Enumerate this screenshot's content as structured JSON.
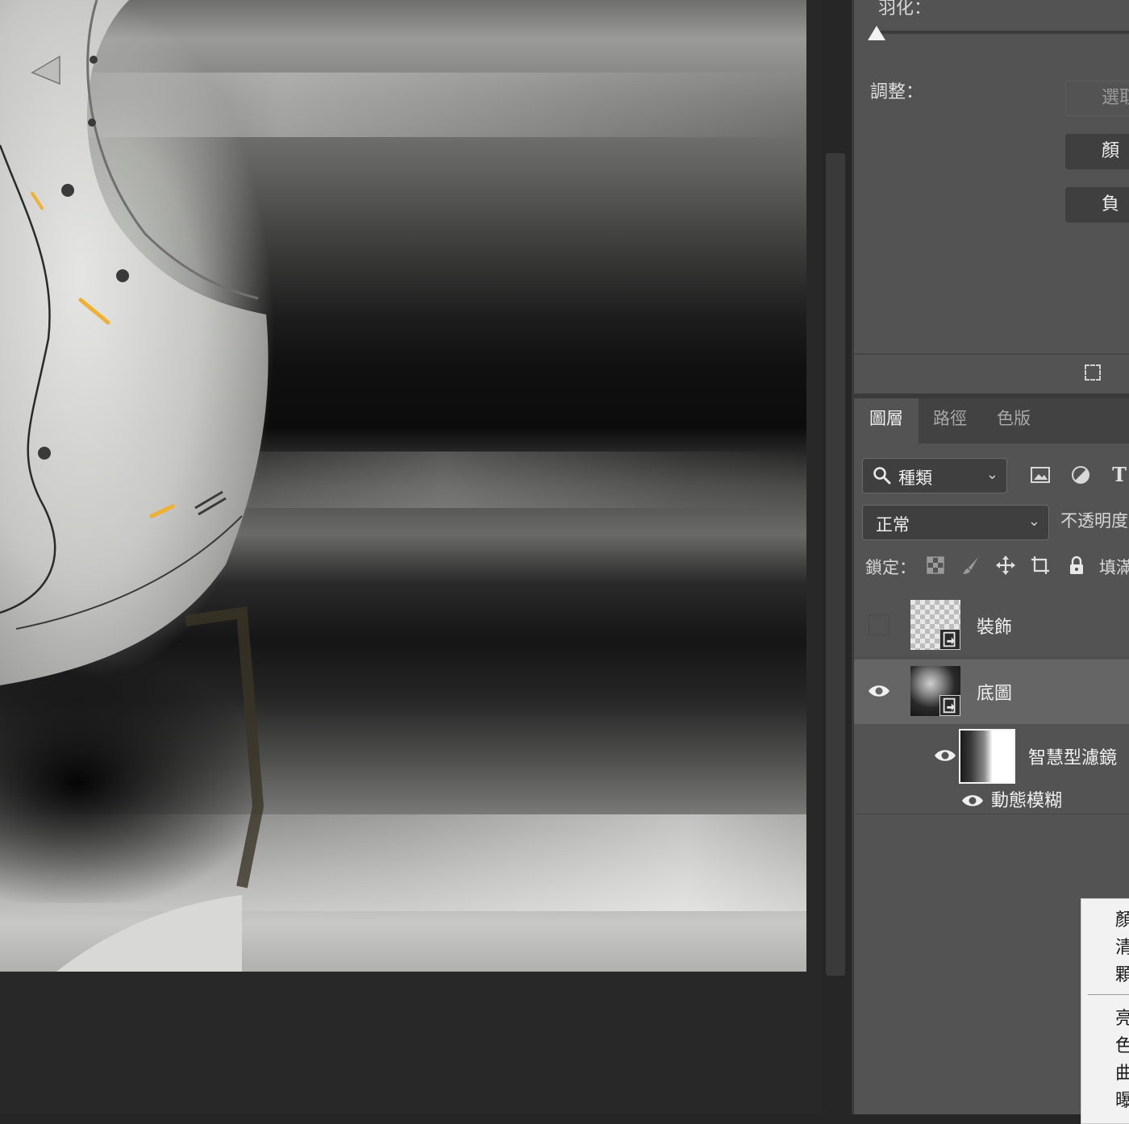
{
  "properties_panel": {
    "feather_label": "羽化：",
    "adjust_label": "調整：",
    "buttons": {
      "select": "選取",
      "color": "顏",
      "negative": "負"
    }
  },
  "tabs": [
    {
      "label": "圖層",
      "active": true
    },
    {
      "label": "路徑",
      "active": false
    },
    {
      "label": "色版",
      "active": false
    }
  ],
  "filter": {
    "kind_label": "種類",
    "icons": [
      "search-icon",
      "image-filter-icon",
      "adjustment-filter-icon",
      "type-filter-icon"
    ],
    "type_glyph": "T"
  },
  "blend": {
    "mode": "正常",
    "opacity_label": "不透明度"
  },
  "lock": {
    "label": "鎖定：",
    "fill_label": "填滿"
  },
  "layers": [
    {
      "name": "裝飾",
      "visible": false,
      "selected": false
    },
    {
      "name": "底圖",
      "visible": true,
      "selected": true
    },
    {
      "name": "智慧型濾鏡",
      "visible": true,
      "selected": false
    },
    {
      "name": "動態模糊",
      "visible": true,
      "selected": false
    }
  ],
  "adjust_menu": {
    "items_top": [
      "顏",
      "清",
      "顆"
    ],
    "items_bottom": [
      "亮",
      "色",
      "曲",
      "曝"
    ]
  },
  "colors": {
    "panel_bg": "#535353",
    "selected_layer_bg": "#656565",
    "workspace_bg": "#282828",
    "menu_bg": "#f2f2f2"
  }
}
